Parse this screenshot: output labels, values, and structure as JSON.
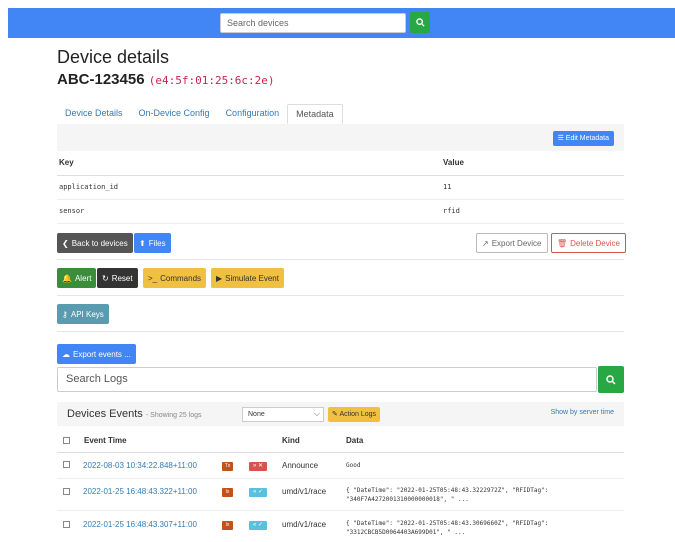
{
  "topbar": {
    "search_placeholder": "Search devices"
  },
  "page": {
    "title": "Device details",
    "device_name": "ABC-123456",
    "device_mac": "(e4:5f:01:25:6c:2e)"
  },
  "tabs": [
    "Device Details",
    "On-Device Config",
    "Configuration",
    "Metadata"
  ],
  "metadata": {
    "edit_label": "Edit Metadata",
    "key_header": "Key",
    "value_header": "Value",
    "rows": [
      {
        "key": "application_id",
        "value": "11"
      },
      {
        "key": "sensor",
        "value": "rfid"
      }
    ]
  },
  "buttons": {
    "back": "Back to devices",
    "files": "Files",
    "export_device": "Export Device",
    "delete_device": "Delete Device",
    "alert": "Alert",
    "reset": "Reset",
    "commands": "Commands",
    "simulate": "Simulate Event",
    "api_keys": "API Keys",
    "export_events": "Export events ..."
  },
  "logs": {
    "search_placeholder": "Search Logs",
    "title": "Devices Events",
    "subtitle": "- Showing 25 logs",
    "filter_value": "None",
    "action_logs": "Action Logs",
    "server_time": "Show by server time",
    "columns": {
      "time": "Event Time",
      "kind": "Kind",
      "data": "Data"
    },
    "rows": [
      {
        "time": "2022-08-03 10:34:22.848+11:00",
        "badge1": "Tx",
        "badge2": "» ✕",
        "badge2_color": "#d9534f",
        "kind": "Announce",
        "data": "Good"
      },
      {
        "time": "2022-01-25 16:48:43.322+11:00",
        "badge1": "Ix",
        "badge2": "« ✓",
        "badge2_color": "#5bc0de",
        "kind": "umd/v1/race",
        "data": "{ \"DateTime\": \"2022-01-25T05:48:43.3222972Z\", \"RFIDTag\":\n\"340F7A4272001310000000018\", \" ..."
      },
      {
        "time": "2022-01-25 16:48:43.307+11:00",
        "badge1": "Ix",
        "badge2": "« ✓",
        "badge2_color": "#5bc0de",
        "kind": "umd/v1/race",
        "data": "{ \"DateTime\": \"2022-01-25T05:48:43.3069660Z\", \"RFIDTag\":\n\"3312CBCB5D0064403A699D01\", \" ..."
      }
    ]
  }
}
